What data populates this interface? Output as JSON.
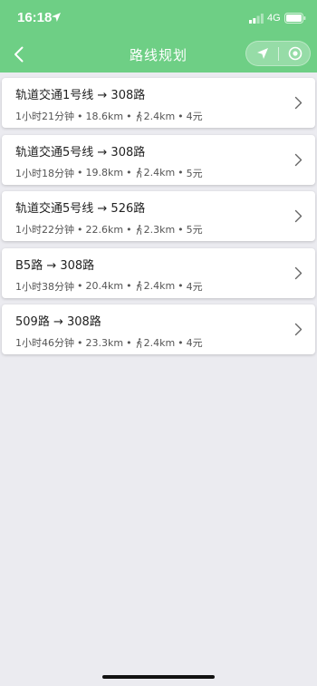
{
  "status_bar": {
    "time": "16:18",
    "network": "4G"
  },
  "nav": {
    "title": "路线规划"
  },
  "routes": [
    {
      "name": "轨道交通1号线 → 308路",
      "duration": "1小时21分钟",
      "distance": "18.6km",
      "walk": "2.4km",
      "fare": "4元"
    },
    {
      "name": "轨道交通5号线 → 308路",
      "duration": "1小时18分钟",
      "distance": "19.8km",
      "walk": "2.4km",
      "fare": "5元"
    },
    {
      "name": "轨道交通5号线 → 526路",
      "duration": "1小时22分钟",
      "distance": "22.6km",
      "walk": "2.3km",
      "fare": "5元"
    },
    {
      "name": "B5路 → 308路",
      "duration": "1小时38分钟",
      "distance": "20.4km",
      "walk": "2.4km",
      "fare": "4元"
    },
    {
      "name": "509路 → 308路",
      "duration": "1小时46分钟",
      "distance": "23.3km",
      "walk": "2.4km",
      "fare": "4元"
    }
  ],
  "separator": "•",
  "colors": {
    "header": "#6ecf85",
    "background": "#ebebf0",
    "card": "#ffffff"
  },
  "icons": {
    "back": "chevron-left-icon",
    "locate": "navigation-arrow-icon",
    "close": "target-circle-icon",
    "walk": "walking-person-icon",
    "row": "chevron-right-icon"
  }
}
